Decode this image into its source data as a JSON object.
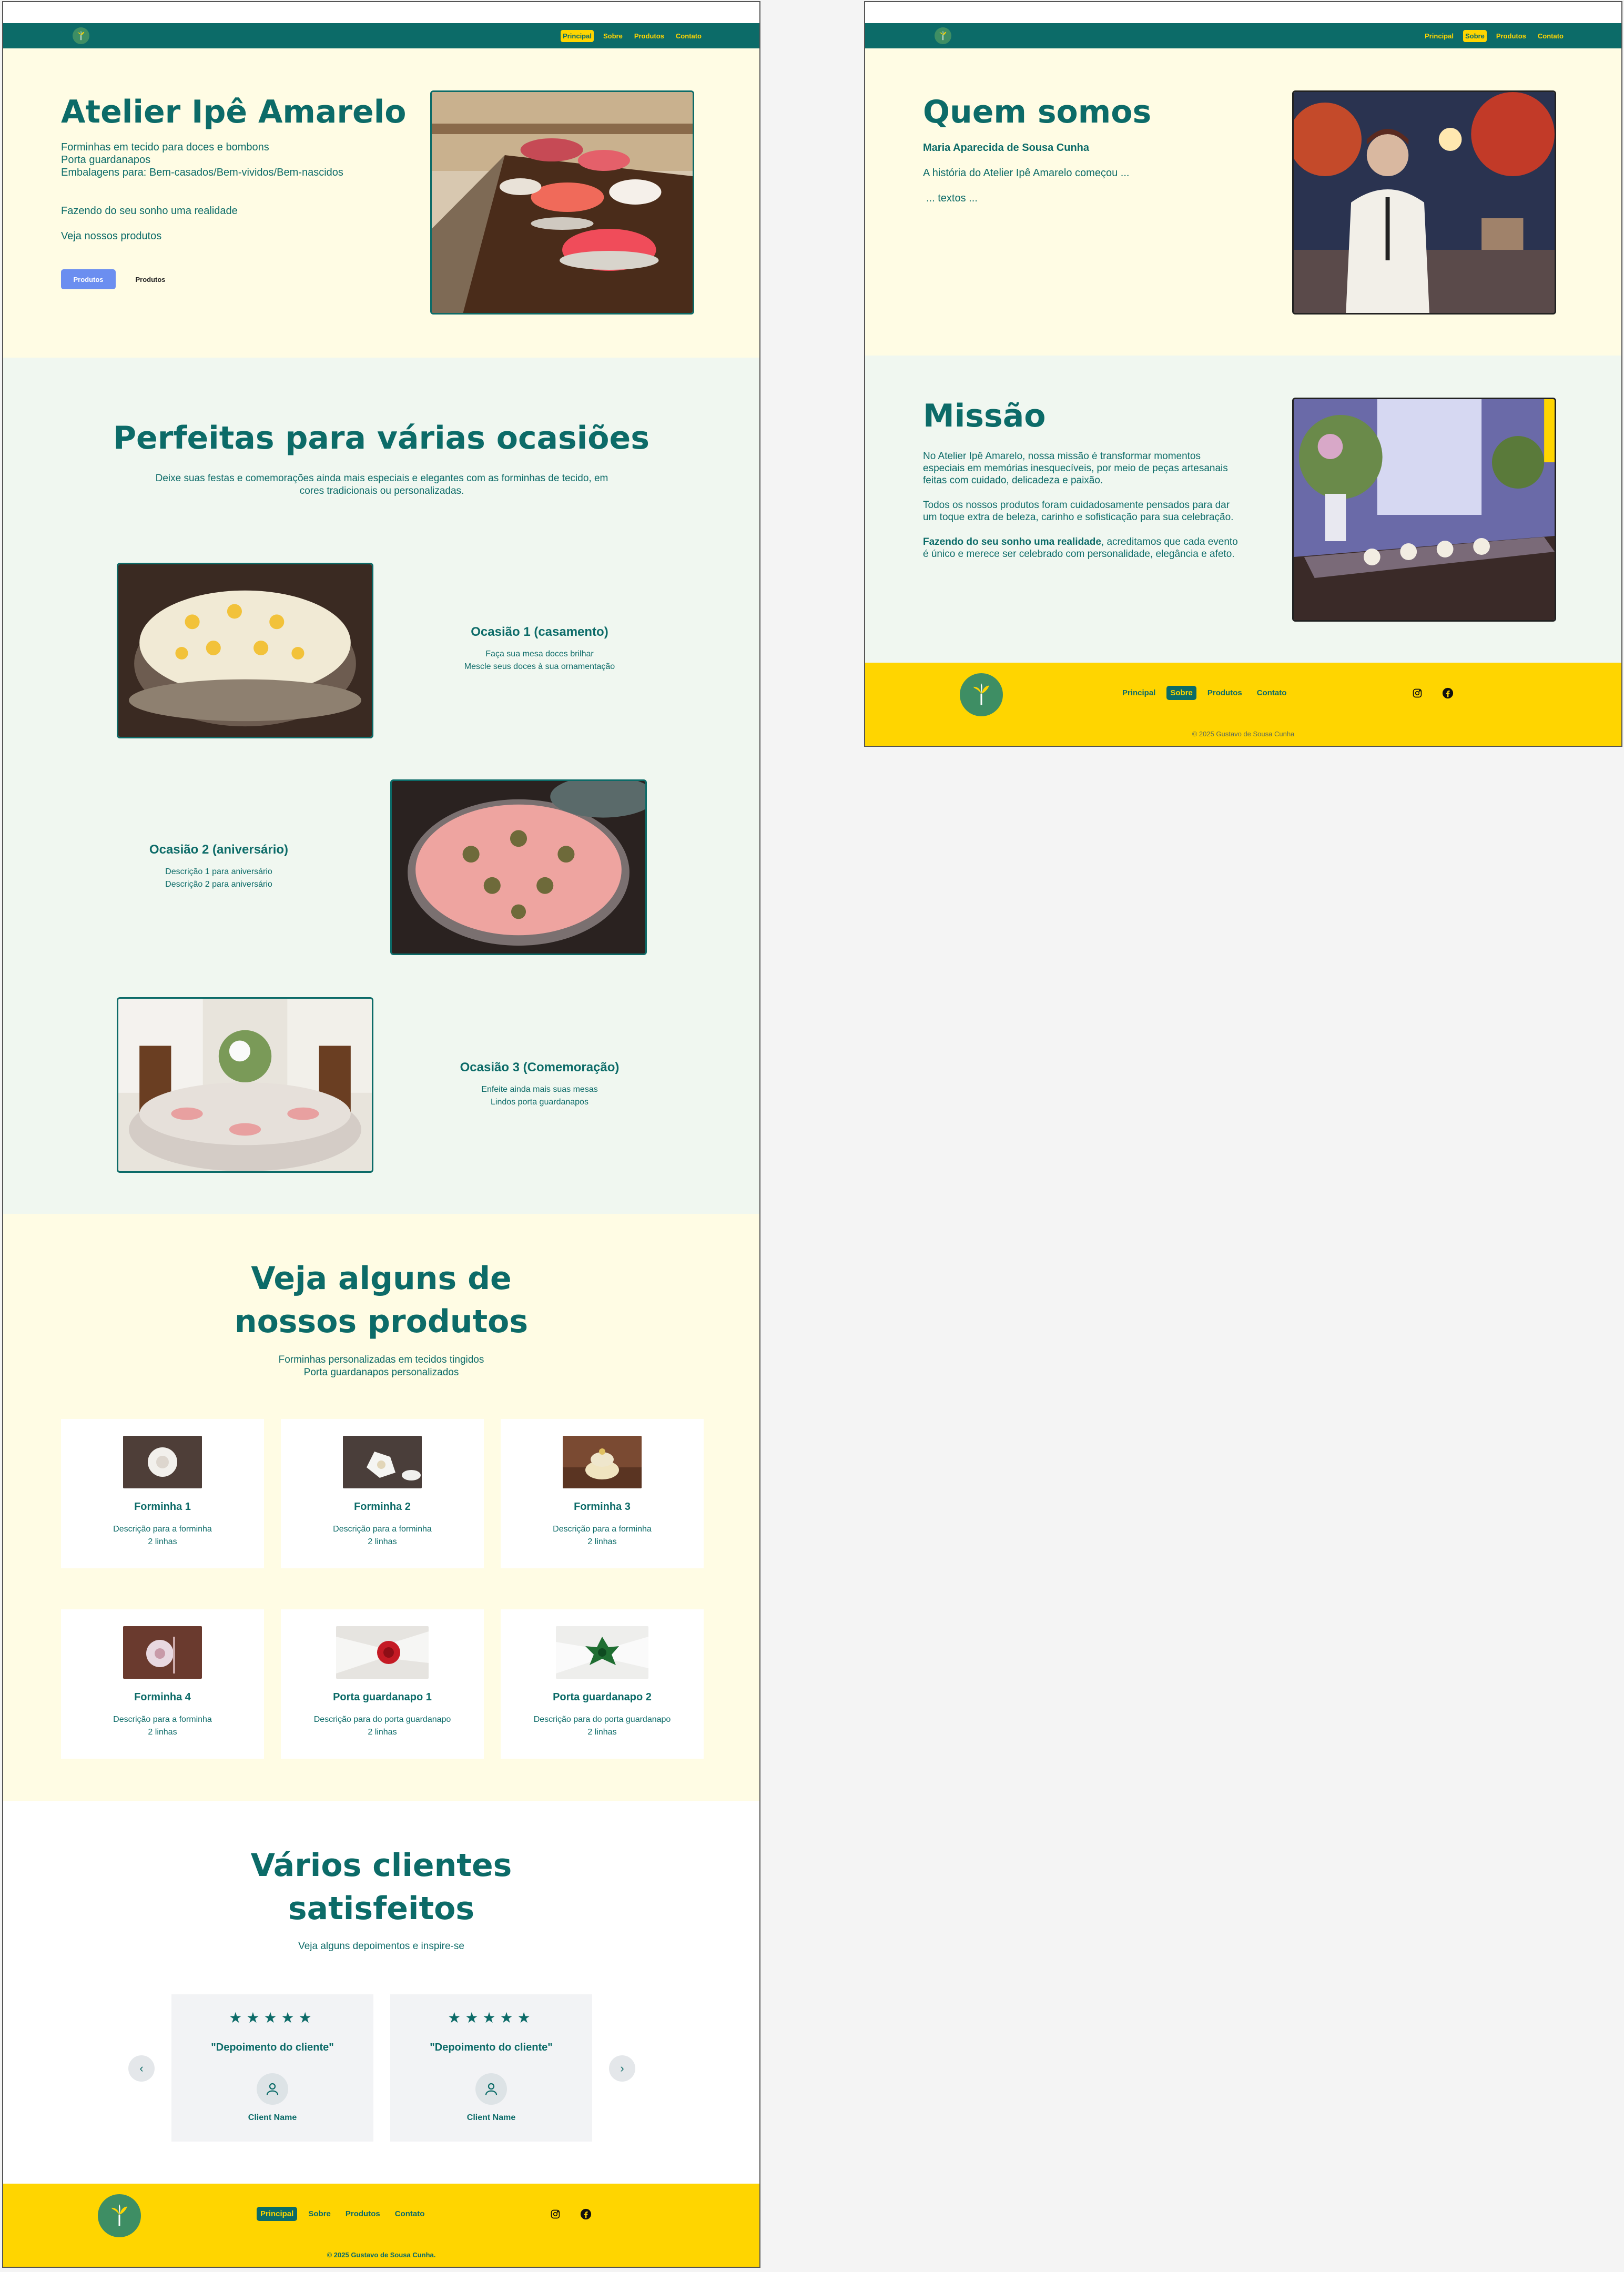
{
  "colors": {
    "primary": "#0c6b68",
    "accent": "#ffd500",
    "hero_bg": "#fffce4",
    "mint_bg": "#f0f7f0",
    "button_blue": "#6b8ef0"
  },
  "nav": {
    "items": [
      "Principal",
      "Sobre",
      "Produtos",
      "Contato"
    ]
  },
  "home": {
    "nav_active": "Principal",
    "hero": {
      "title": "Atelier Ipê Amarelo",
      "lines": [
        "Forminhas em tecido para doces e bombons",
        "Porta guardanapos",
        "Embalagens para: Bem-casados/Bem-vividos/Bem-nascidos"
      ],
      "slogan": "Fazendo do seu sonho uma realidade",
      "cta_text": "Veja nossos produtos",
      "btn_primary": "Produtos",
      "btn_secondary": "Produtos"
    },
    "occasions": {
      "title": "Perfeitas para várias ocasiões",
      "subtitle": "Deixe suas festas e comemorações ainda mais especiais e elegantes com as forminhas de tecido, em cores tradicionais ou personalizadas.",
      "items": [
        {
          "title": "Ocasião 1 (casamento)",
          "lines": [
            "Faça sua mesa doces brilhar",
            "Mescle seus doces à sua ornamentação"
          ]
        },
        {
          "title": "Ocasião 2 (aniversário)",
          "lines": [
            "Descrição 1 para aniversário",
            "Descrição 2 para aniversário"
          ]
        },
        {
          "title": "Ocasião 3 (Comemoração)",
          "lines": [
            "Enfeite ainda mais suas mesas",
            "Lindos porta guardanapos"
          ]
        }
      ]
    },
    "products": {
      "title_line1": "Veja alguns de",
      "title_line2": "nossos produtos",
      "subtitle_line1": "Forminhas personalizadas em tecidos tingidos",
      "subtitle_line2": "Porta guardanapos personalizados",
      "items": [
        {
          "name": "Forminha 1",
          "desc1": "Descrição para a forminha",
          "desc2": "2 linhas"
        },
        {
          "name": "Forminha 2",
          "desc1": "Descrição para a forminha",
          "desc2": "2 linhas"
        },
        {
          "name": "Forminha 3",
          "desc1": "Descrição para a forminha",
          "desc2": "2 linhas"
        },
        {
          "name": "Forminha 4",
          "desc1": "Descrição para a forminha",
          "desc2": "2 linhas"
        },
        {
          "name": "Porta guardanapo 1",
          "desc1": "Descrição para do porta guardanapo",
          "desc2": "2 linhas"
        },
        {
          "name": "Porta guardanapo 2",
          "desc1": "Descrição para do porta guardanapo",
          "desc2": "2 linhas"
        }
      ]
    },
    "testimonials": {
      "title_line1": "Vários clientes",
      "title_line2": "satisfeitos",
      "subtitle": "Veja alguns depoimentos e inspire-se",
      "stars": "★★★★★",
      "rating": 5,
      "items": [
        {
          "quote": "\"Depoimento do cliente\"",
          "name": "Client Name"
        },
        {
          "quote": "\"Depoimento do cliente\"",
          "name": "Client Name"
        }
      ],
      "prev": "‹",
      "next": "›"
    },
    "footer": {
      "nav_active": "Principal",
      "copyright": "© 2025 Gustavo de Sousa Cunha."
    }
  },
  "about": {
    "nav_active": "Sobre",
    "who": {
      "title": "Quem somos",
      "name": "Maria Aparecida de Sousa Cunha",
      "story": "A história do Atelier Ipê Amarelo começou ...",
      "more": "... textos ..."
    },
    "mission": {
      "title": "Missão",
      "p1": "No Atelier Ipê Amarelo, nossa missão é transformar momentos especiais em memórias inesquecíveis, por meio de peças artesanais feitas com cuidado, delicadeza e paixão.",
      "p2": "Todos os nossos produtos foram cuidadosamente pensados para dar um toque extra de beleza, carinho e sofisticação para sua celebração.",
      "p3_bold": "Fazendo do seu sonho uma realidade",
      "p3_rest": ", acreditamos que cada evento é único e merece ser celebrado com personalidade, elegância e afeto."
    },
    "footer": {
      "nav_active": "Sobre",
      "copyright": "© 2025 Gustavo de Sousa Cunha"
    }
  },
  "icons": {
    "logo": "ipe-flower-logo",
    "social": [
      "instagram-icon",
      "facebook-icon"
    ],
    "avatar": "user-icon"
  }
}
